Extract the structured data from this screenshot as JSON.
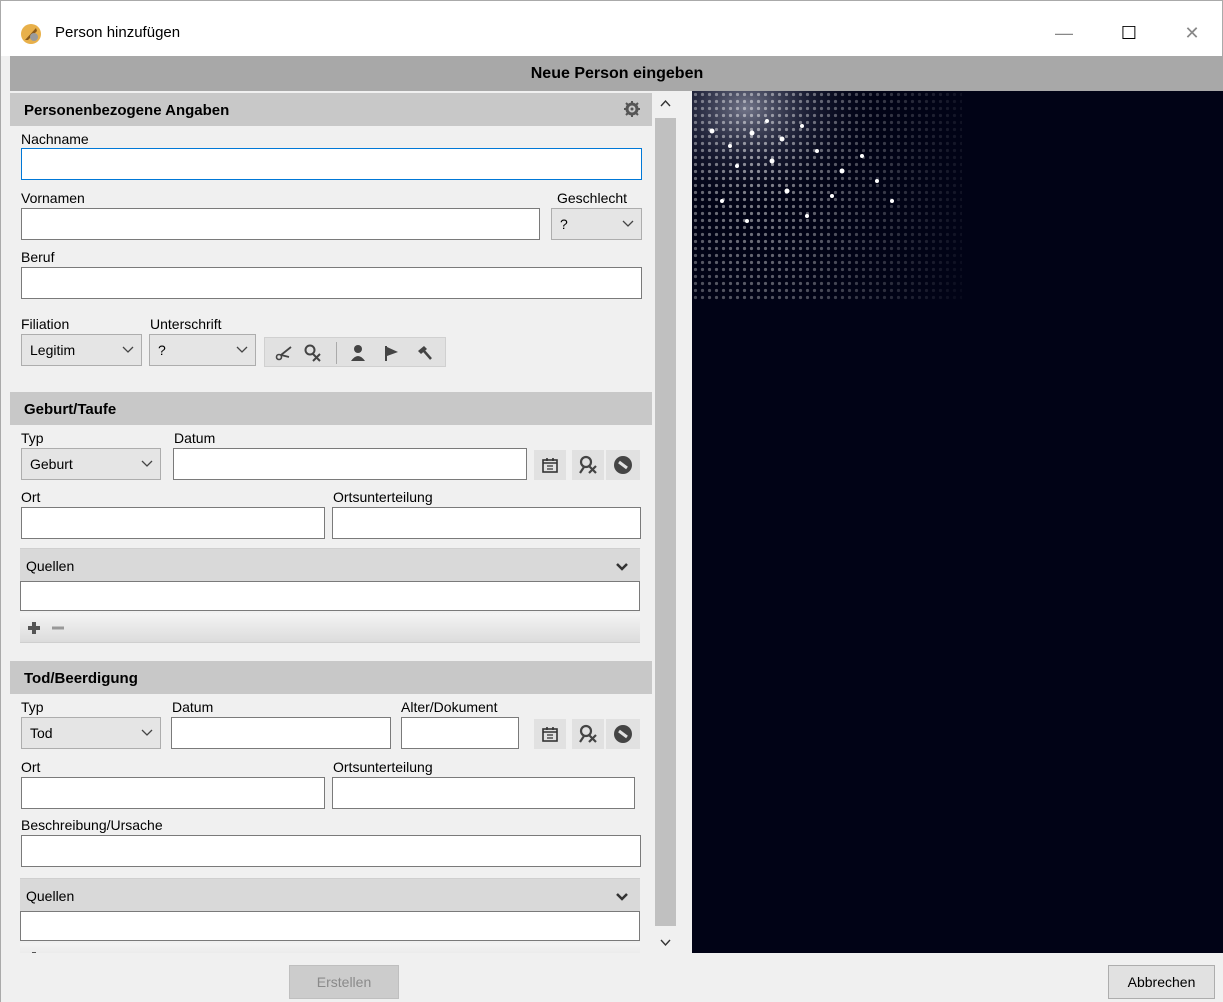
{
  "window": {
    "title": "Person hinzufügen",
    "controls": {
      "minimize": "—",
      "maximize": "☐",
      "close": "✕"
    }
  },
  "header": {
    "title": "Neue Person eingeben"
  },
  "personal": {
    "heading": "Personenbezogene Angaben",
    "lastname_label": "Nachname",
    "lastname_value": "",
    "firstnames_label": "Vornamen",
    "firstnames_value": "",
    "gender_label": "Geschlecht",
    "gender_value": "?",
    "profession_label": "Beruf",
    "profession_value": "",
    "filiation_label": "Filiation",
    "filiation_value": "Legitim",
    "signature_label": "Unterschrift",
    "signature_value": "?"
  },
  "birth": {
    "heading": "Geburt/Taufe",
    "type_label": "Typ",
    "type_value": "Geburt",
    "date_label": "Datum",
    "place_label": "Ort",
    "subdivision_label": "Ortsunterteilung",
    "sources_label": "Quellen"
  },
  "death": {
    "heading": "Tod/Beerdigung",
    "type_label": "Typ",
    "type_value": "Tod",
    "date_label": "Datum",
    "age_label": "Alter/Dokument",
    "place_label": "Ort",
    "subdivision_label": "Ortsunterteilung",
    "description_label": "Beschreibung/Ursache",
    "sources_label": "Quellen"
  },
  "footer": {
    "create_label": "Erstellen",
    "cancel_label": "Abbrechen"
  },
  "colors": {
    "header_bar": "#a8a8a8",
    "section_head": "#c8c8c8",
    "focus_border": "#0078d7",
    "preview_bg": "#010316"
  },
  "icons": [
    "app-feather-icon",
    "gear-icon",
    "scissors-icon",
    "unlink-person-icon",
    "person-icon",
    "flag-icon",
    "hammer-icon",
    "calendar-icon",
    "witness-icon",
    "globe-icon",
    "plus-icon",
    "minus-icon",
    "chevron-down-icon"
  ]
}
